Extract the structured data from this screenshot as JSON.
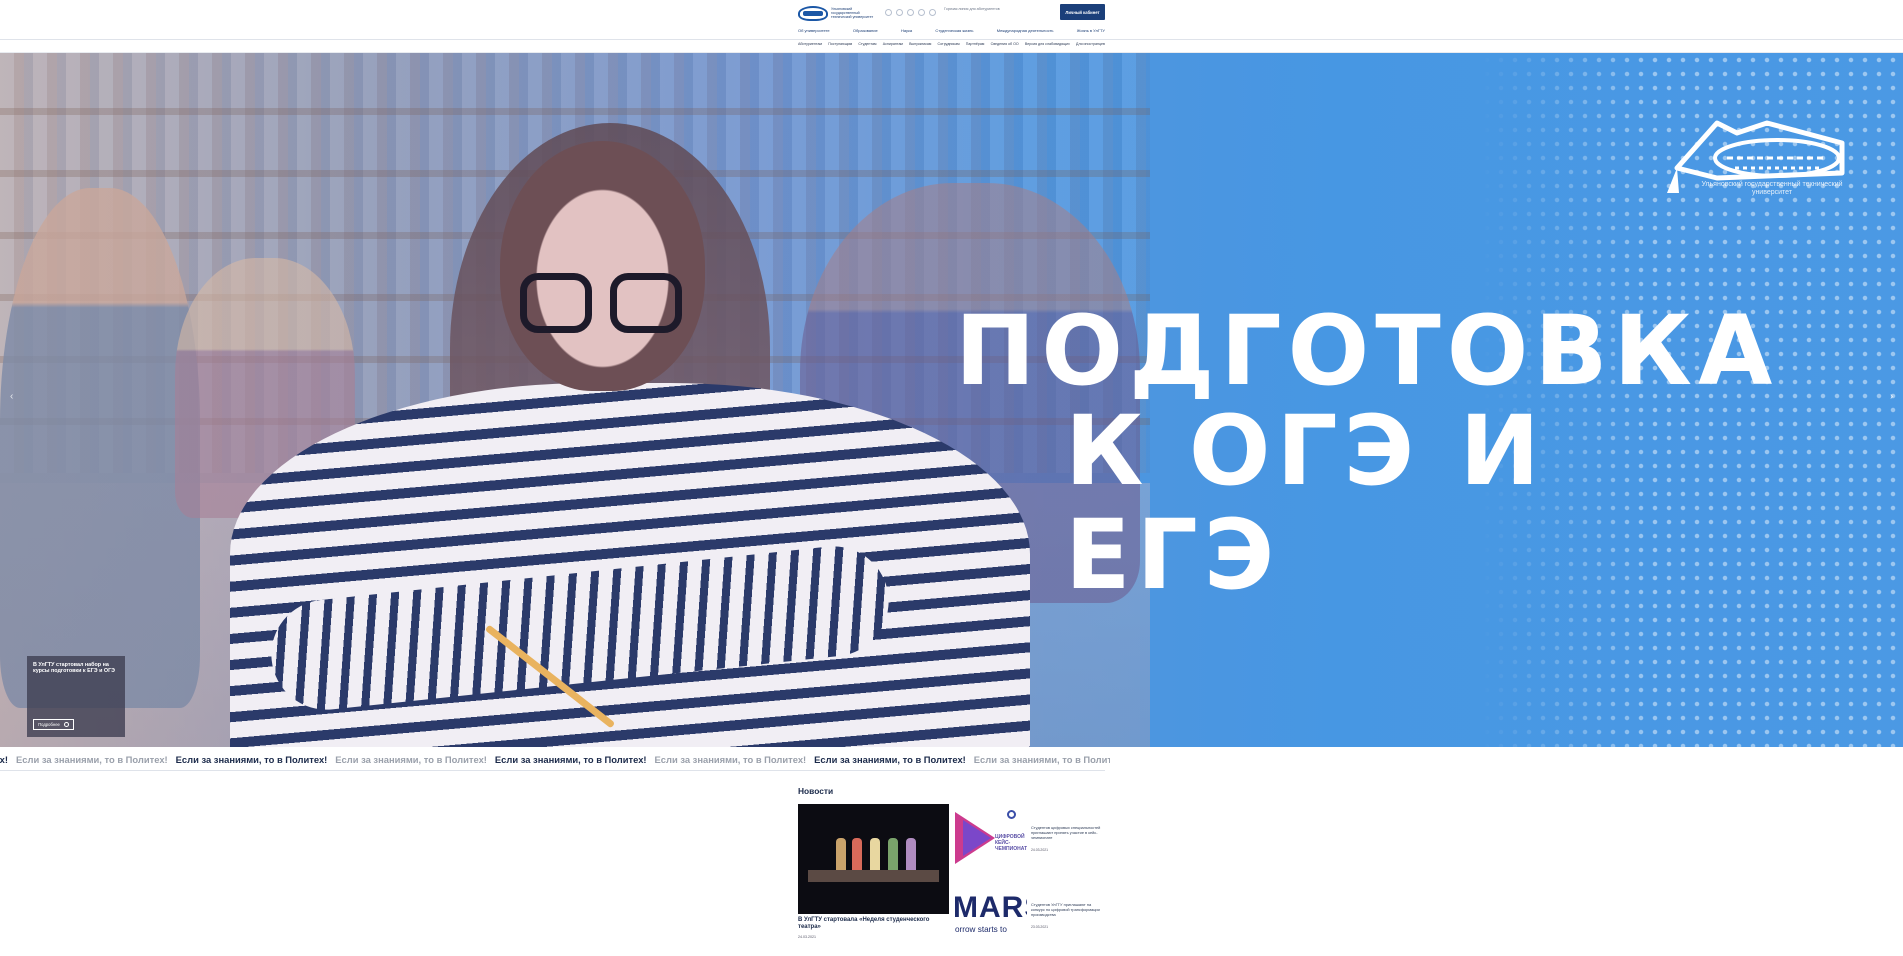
{
  "header": {
    "logo_text": "Ульяновский государственный технический университет",
    "hotline_text": "Горячая линия для абитуриентов",
    "cabinet_button": "Личный кабинет",
    "social_icons": [
      "vk-icon",
      "ok-icon",
      "telegram-icon",
      "youtube-icon",
      "rutube-icon"
    ],
    "main_nav": [
      "Об университете",
      "Образование",
      "Наука",
      "Студенческая жизнь",
      "Международная деятельность",
      "Жизнь в УлГТУ"
    ],
    "sub_nav": [
      "Абитуриентам",
      "Поступающим",
      "Студентам",
      "Аспирантам",
      "Выпускникам",
      "Сотрудникам",
      "Партнёрам",
      "Сведения об ОО",
      "Версия для слабовидящих",
      "Для иностранцев"
    ]
  },
  "hero": {
    "title_line1": "ПОДГОТОВКА",
    "title_line2": "К ОГЭ И ЕГЭ",
    "logo_caption": "Ульяновский государственный технический университет",
    "news_card_title": "В УлГТУ стартовал набор на курсы подготовки к ЕГЭ и ОГЭ",
    "news_card_button": "Подробнее",
    "prev_arrow": "‹",
    "next_arrow": "›"
  },
  "ticker": {
    "items": [
      {
        "text": "Если за знаниями, то в Политех!",
        "tone": "dark"
      },
      {
        "text": "Если за знаниями, то в Политех!",
        "tone": "light"
      },
      {
        "text": "Если за знаниями, то в Политех!",
        "tone": "dark"
      },
      {
        "text": "Если за знаниями, то в Политех!",
        "tone": "light"
      },
      {
        "text": "Если за знаниями, то в Политех!",
        "tone": "dark"
      },
      {
        "text": "Если за знаниями, то в Политех!",
        "tone": "light"
      },
      {
        "text": "Если за знаниями, то в Политех!",
        "tone": "dark"
      },
      {
        "text": "Если за знаниями, то в Политех!",
        "tone": "light"
      }
    ],
    "lead_fragment": "тех!"
  },
  "news": {
    "heading": "Новости",
    "main": {
      "title": "В УлГТУ стартовала «Неделя студенческого театра»",
      "date": "24.03.2021"
    },
    "side": [
      {
        "image_label": "ЦИФРОВОЙ КЕЙС-ЧЕМПИОНАТ",
        "text": "Студентов цифровых специальностей приглашают принять участие в кейс-чемпионате",
        "date": "24.03.2021"
      },
      {
        "image_label": "MARS",
        "image_sub": "orrow starts to",
        "text": "Студентов УлГТУ приглашают на конкурс по цифровой трансформации производства",
        "date": "23.03.2021"
      }
    ]
  },
  "colors": {
    "brand_blue": "#1b3f7a",
    "hero_blue": "#4797e3",
    "ticker_dark": "#1b2a4a",
    "ticker_light": "#9aa0ab"
  }
}
